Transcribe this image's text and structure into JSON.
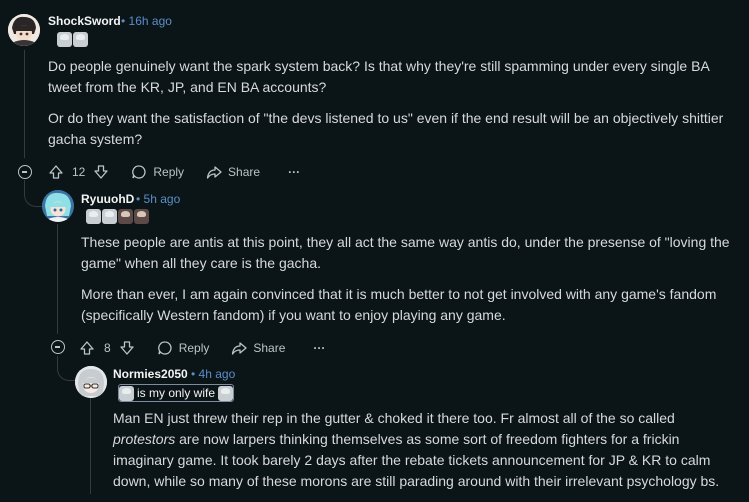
{
  "comments": [
    {
      "username": "ShockSword",
      "time": "16h ago",
      "flair_icons": [
        "anime-emote-1",
        "anime-emote-2"
      ],
      "paragraphs": [
        "Do people genuinely want the spark system back? Is that why they're still spamming under every single BA tweet from the KR, JP, and EN BA accounts?",
        "Or do they want the satisfaction of \"the devs listened to us\" even if the end result will be an objectively shittier gacha system?"
      ],
      "votes": "12",
      "reply_label": "Reply",
      "share_label": "Share",
      "more_label": "···"
    },
    {
      "username": "RyuuohD",
      "time": "5h ago",
      "flair_icons": [
        "anime-emote-1",
        "anime-emote-2",
        "anime-emote-3",
        "anime-emote-4"
      ],
      "paragraphs": [
        "These people are antis at this point, they all act the same way antis do, under the presense of \"loving the game\" when all they care is the gacha.",
        "More than ever, I am again convinced that it is much better to not get involved with any game's fandom (specifically Western fandom) if you want to enjoy playing any game."
      ],
      "votes": "8",
      "reply_label": "Reply",
      "share_label": "Share",
      "more_label": "···"
    },
    {
      "username": "Normies2050",
      "time": "4h ago",
      "flair_text": "is my only wife",
      "body": {
        "part1": "Man EN just threw their rep in the gutter & choked it there too. Fr almost all of the so called ",
        "italic": "protestors",
        "part2": " are now larpers thinking themselves as some sort of freedom fighters for a frickin imaginary game. It took barely 2 days after the rebate tickets announcement for JP & KR to calm down, while so many of these morons are still parading around with their irrelevant psychology bs."
      }
    }
  ],
  "colors": {
    "background": "#0b1416",
    "time_blue": "#5b8ec9",
    "text": "#d7dadc",
    "muted": "#b8c5c9",
    "thread_line": "#343a3d"
  }
}
